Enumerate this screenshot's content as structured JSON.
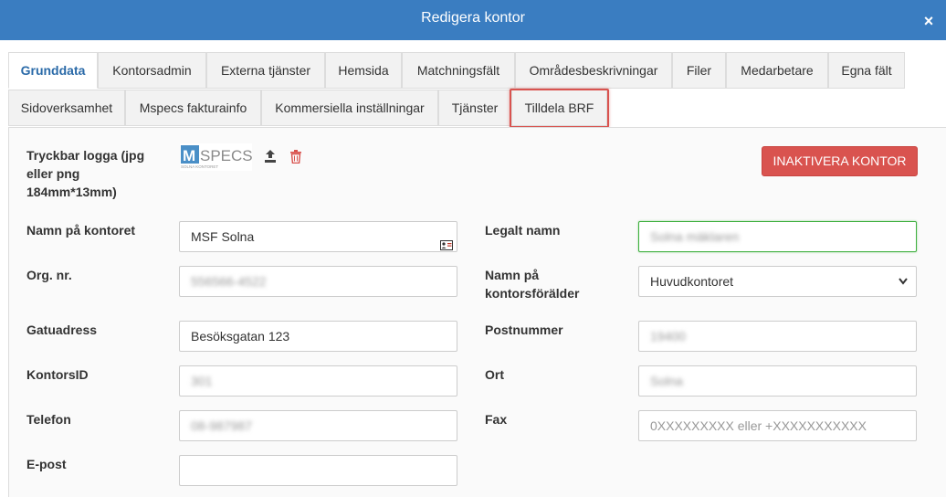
{
  "dialog": {
    "title": "Redigera kontor",
    "close_label": "×"
  },
  "tabs": [
    {
      "label": "Grunddata",
      "active": true
    },
    {
      "label": "Kontorsadmin"
    },
    {
      "label": "Externa tjänster"
    },
    {
      "label": "Hemsida"
    },
    {
      "label": "Matchningsfält"
    },
    {
      "label": "Områdesbeskrivningar"
    },
    {
      "label": "Filer"
    },
    {
      "label": "Medarbetare"
    },
    {
      "label": "Egna fält"
    },
    {
      "label": "Sidoverksamhet"
    },
    {
      "label": "Mspecs fakturainfo"
    },
    {
      "label": "Kommersiella inställningar"
    },
    {
      "label": "Tjänster"
    },
    {
      "label": "Tilldela BRF",
      "highlighted": true
    }
  ],
  "logo": {
    "label_line1": "Tryckbar logga (jpg",
    "label_line2": "eller png",
    "label_line3": "184mm*13mm)",
    "brand_m": "M",
    "brand_specs": "SPECS",
    "brand_sub": "SOLNA KONTORET"
  },
  "deactivate_button": "INAKTIVERA KONTOR",
  "form": {
    "office_name": {
      "label": "Namn på kontoret",
      "value": "MSF Solna"
    },
    "legal_name": {
      "label": "Legalt namn",
      "value": "Solna mäklaren"
    },
    "org_nr": {
      "label": "Org. nr.",
      "value": "556566-4522"
    },
    "parent": {
      "label_line1": "Namn på",
      "label_line2": "kontorsförälder",
      "value": "Huvudkontoret"
    },
    "street": {
      "label": "Gatuadress",
      "value": "Besöksgatan 123"
    },
    "postal": {
      "label": "Postnummer",
      "value": "19400"
    },
    "office_id": {
      "label": "KontorsID",
      "value": "301"
    },
    "city": {
      "label": "Ort",
      "value": "Solna"
    },
    "phone": {
      "label": "Telefon",
      "value": "08-987987"
    },
    "fax": {
      "label": "Fax",
      "placeholder": "0XXXXXXXXX eller +XXXXXXXXXXX"
    },
    "email": {
      "label": "E-post",
      "value": ""
    }
  },
  "colors": {
    "header": "#3a7dc1",
    "danger": "#d9534f",
    "active_tab": "#2a6aa8",
    "valid_border": "#3fb03f"
  }
}
